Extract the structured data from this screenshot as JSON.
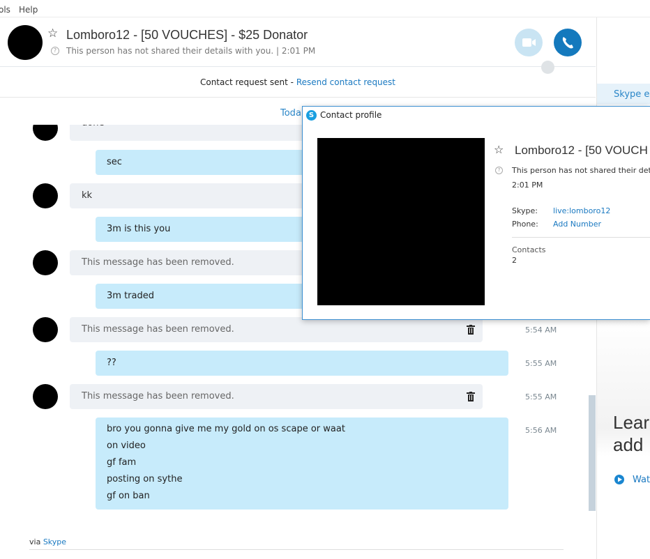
{
  "menubar": {
    "items": [
      "ols",
      "Help"
    ]
  },
  "header": {
    "title": "Lomboro12 - [50 VOUCHES] - $25 Donator",
    "subtitle": "This person has not shared their details with you.  |  2:01 PM"
  },
  "request_bar": {
    "text": "Contact request sent - ",
    "link": "Resend contact request"
  },
  "chat": {
    "today_label": "Toda",
    "messages": [
      {
        "text": "done"
      },
      {
        "text": "sec"
      },
      {
        "text": "kk"
      },
      {
        "text": "3m is this you"
      },
      {
        "text": "This message has been removed."
      },
      {
        "text": "3m traded"
      },
      {
        "text": "This message has been removed.",
        "time": "5:54 AM"
      },
      {
        "text": "??",
        "time": "5:55 AM"
      },
      {
        "text": "This message has been removed.",
        "time": "5:55 AM"
      },
      {
        "lines": [
          "bro you gonna give me my gold on os scape or waat",
          "on video",
          "gf fam",
          "posting on sythe",
          "gf on ban"
        ],
        "time": "5:56 AM"
      }
    ],
    "via_text": "via ",
    "via_link": "Skype"
  },
  "right_pane": {
    "tab_label": "Skype es",
    "promo_line1": "Lear",
    "promo_line2": "add",
    "watch_label": "Wat"
  },
  "profile_dialog": {
    "title": "Contact profile",
    "name": "Lomboro12 - [50 VOUCH",
    "info": "This person has not shared their detail",
    "time": "2:01 PM",
    "skype_label": "Skype:",
    "skype_value": "live:lomboro12",
    "phone_label": "Phone:",
    "phone_value": "Add Number",
    "contacts_label": "Contacts",
    "contacts_count": "2"
  },
  "colors": {
    "accent": "#1a79c1",
    "outgoing_bubble": "#c7ebfb",
    "incoming_bubble": "#eef1f5",
    "call_button": "#1479bd"
  }
}
